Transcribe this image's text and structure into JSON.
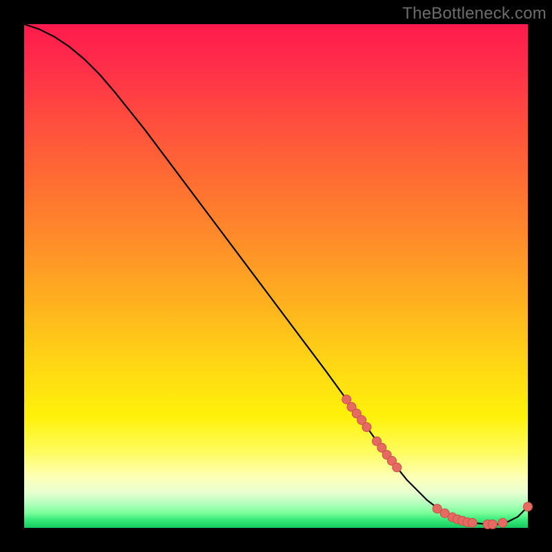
{
  "watermark": {
    "text": "TheBottleneck.com"
  },
  "colors": {
    "page_bg": "#000000",
    "curve": "#000000",
    "marker_fill": "#e56a62",
    "marker_stroke": "#c94f47"
  },
  "chart_data": {
    "type": "line",
    "title": "",
    "xlabel": "",
    "ylabel": "",
    "xlim": [
      0,
      100
    ],
    "ylim": [
      0,
      100
    ],
    "grid": false,
    "legend": false,
    "series": [
      {
        "name": "curve",
        "x": [
          0,
          3,
          6,
          9,
          12,
          15,
          18,
          24,
          30,
          36,
          42,
          48,
          54,
          60,
          64,
          68,
          72,
          76,
          80,
          83,
          86,
          89,
          92,
          94,
          96,
          98,
          100
        ],
        "y": [
          100,
          99,
          97.5,
          95.5,
          93,
          90,
          86.5,
          79,
          71,
          63,
          55,
          47,
          39,
          31,
          25.5,
          20,
          14.5,
          9.5,
          5.5,
          3.2,
          1.8,
          1.0,
          0.7,
          0.7,
          1.2,
          2.2,
          4.2
        ]
      }
    ],
    "markers": [
      {
        "x": 64.0,
        "y": 25.5
      },
      {
        "x": 65.0,
        "y": 24.0
      },
      {
        "x": 66.0,
        "y": 22.7
      },
      {
        "x": 67.0,
        "y": 21.4
      },
      {
        "x": 68.0,
        "y": 20.0
      },
      {
        "x": 70.0,
        "y": 17.2
      },
      {
        "x": 71.0,
        "y": 15.9
      },
      {
        "x": 72.0,
        "y": 14.5
      },
      {
        "x": 73.0,
        "y": 13.3
      },
      {
        "x": 74.0,
        "y": 12.0
      },
      {
        "x": 82.0,
        "y": 3.8
      },
      {
        "x": 83.5,
        "y": 2.9
      },
      {
        "x": 85.0,
        "y": 2.1
      },
      {
        "x": 86.0,
        "y": 1.7
      },
      {
        "x": 87.0,
        "y": 1.4
      },
      {
        "x": 88.0,
        "y": 1.1
      },
      {
        "x": 89.0,
        "y": 1.0
      },
      {
        "x": 92.0,
        "y": 0.7
      },
      {
        "x": 93.0,
        "y": 0.7
      },
      {
        "x": 95.0,
        "y": 1.0
      },
      {
        "x": 100.0,
        "y": 4.2
      }
    ]
  }
}
